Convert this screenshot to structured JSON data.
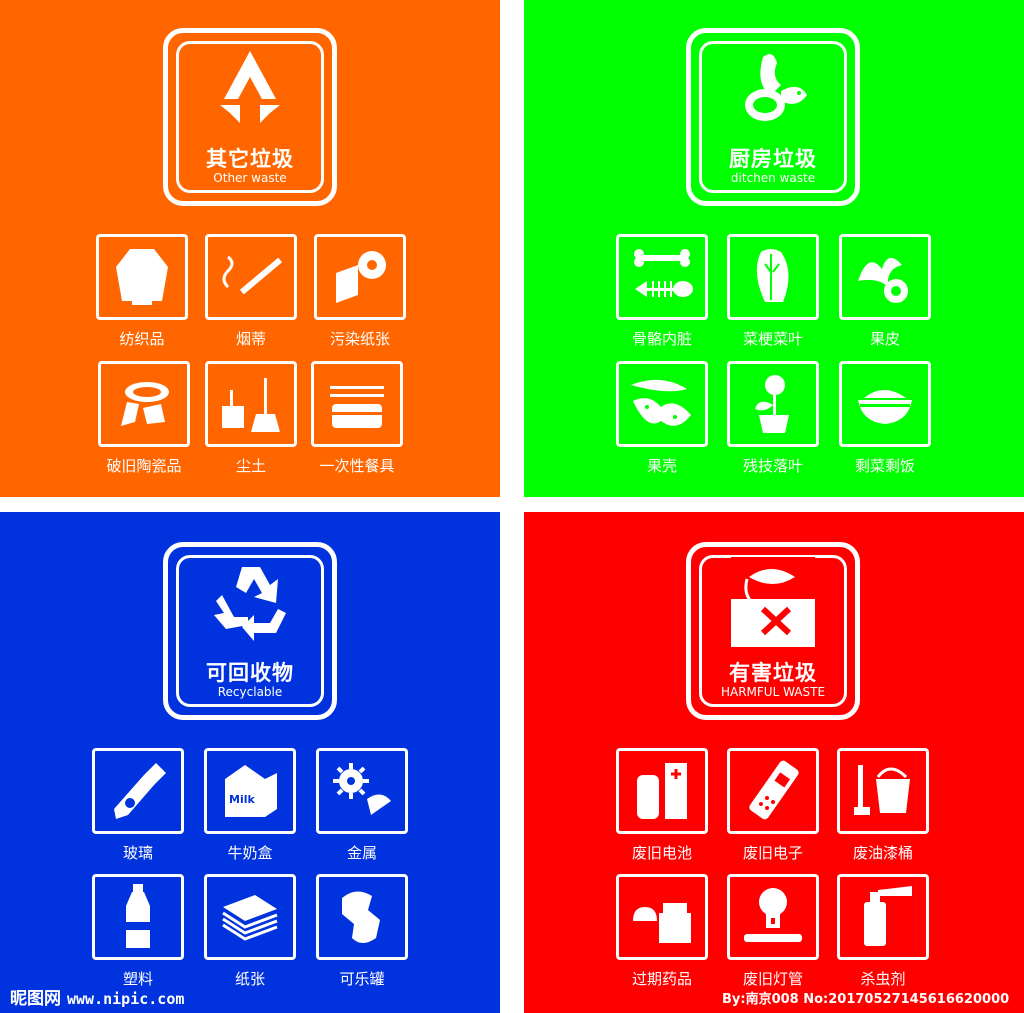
{
  "panels": {
    "other": {
      "title_zh": "其它垃圾",
      "title_en": "Other waste",
      "color": "#ff6600",
      "items": [
        {
          "label": "纺织品",
          "icon": "clothing-icon"
        },
        {
          "label": "烟蒂",
          "icon": "cigarette-icon"
        },
        {
          "label": "污染纸张",
          "icon": "paper-roll-icon"
        },
        {
          "label": "破旧陶瓷品",
          "icon": "broken-ceramic-icon"
        },
        {
          "label": "尘土",
          "icon": "dustpan-broom-icon"
        },
        {
          "label": "一次性餐具",
          "icon": "disposable-tableware-icon"
        }
      ]
    },
    "kitchen": {
      "title_zh": "厨房垃圾",
      "title_en": "ditchen waste",
      "color": "#00ff00",
      "items": [
        {
          "label": "骨骼内脏",
          "icon": "bone-fish-icon"
        },
        {
          "label": "菜梗菜叶",
          "icon": "cabbage-icon"
        },
        {
          "label": "果皮",
          "icon": "fruit-peel-icon"
        },
        {
          "label": "果壳",
          "icon": "peanut-shell-icon"
        },
        {
          "label": "残技落叶",
          "icon": "potted-plant-icon"
        },
        {
          "label": "剩菜剩饭",
          "icon": "rice-bowl-icon"
        }
      ]
    },
    "recyclable": {
      "title_zh": "可回收物",
      "title_en": "Recyclable",
      "color": "#0033dd",
      "items": [
        {
          "label": "玻璃",
          "icon": "glass-bottle-icon"
        },
        {
          "label": "牛奶盒",
          "icon": "milk-carton-icon",
          "icon_text": "Milk"
        },
        {
          "label": "金属",
          "icon": "metal-parts-icon"
        },
        {
          "label": "塑料",
          "icon": "plastic-bottle-icon"
        },
        {
          "label": "纸张",
          "icon": "paper-stack-icon"
        },
        {
          "label": "可乐罐",
          "icon": "crushed-can-icon"
        }
      ]
    },
    "harmful": {
      "title_zh": "有害垃圾",
      "title_en": "HARMFUL WASTE",
      "color": "#ff0000",
      "items": [
        {
          "label": "废旧电池",
          "icon": "battery-icon"
        },
        {
          "label": "废旧电子",
          "icon": "mobile-phone-icon"
        },
        {
          "label": "废油漆桶",
          "icon": "paint-bucket-icon"
        },
        {
          "label": "过期药品",
          "icon": "medicine-bottle-icon"
        },
        {
          "label": "废旧灯管",
          "icon": "light-tube-icon"
        },
        {
          "label": "杀虫剂",
          "icon": "spray-can-icon"
        }
      ]
    }
  },
  "watermark": {
    "site_name": "昵图网",
    "site_url": "www.nipic.com",
    "credit": "By:南京008 No:20170527145616620000"
  }
}
